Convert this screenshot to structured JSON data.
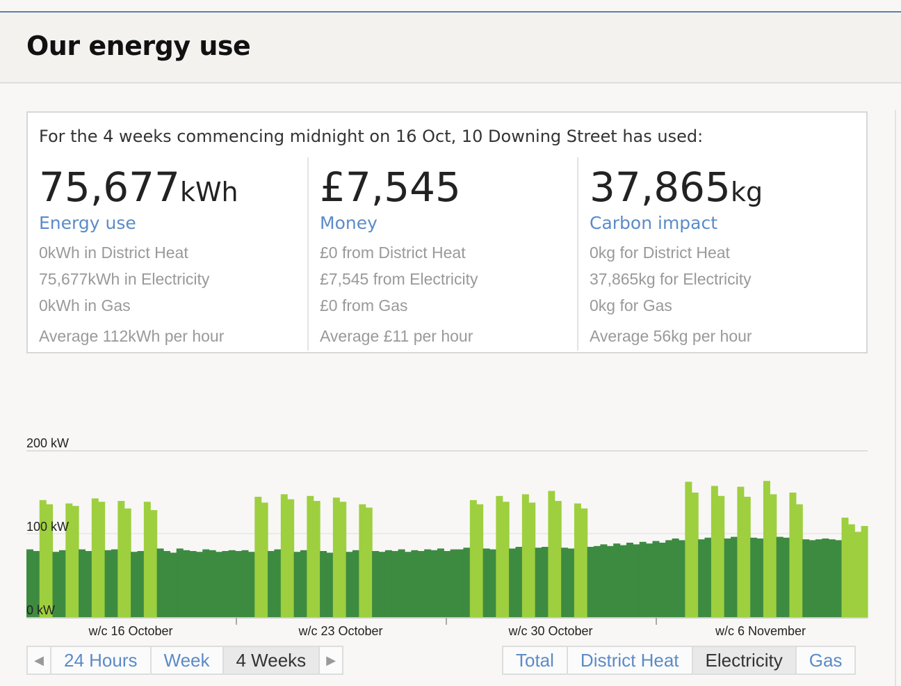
{
  "page": {
    "title": "Our energy use"
  },
  "summary": {
    "intro": "For the 4 weeks commencing midnight on 16 Oct, 10 Downing Street has used:",
    "energy": {
      "value": "75,677",
      "unit": "kWh",
      "label": "Energy use",
      "lines": [
        "0kWh in District Heat",
        "75,677kWh in Electricity",
        "0kWh in Gas",
        "Average 112kWh per hour"
      ]
    },
    "money": {
      "value": "£7,545",
      "unit": "",
      "label": "Money",
      "lines": [
        "£0 from District Heat",
        "£7,545 from Electricity",
        "£0 from Gas",
        "Average £11 per hour"
      ]
    },
    "carbon": {
      "value": "37,865",
      "unit": "kg",
      "label": "Carbon impact",
      "lines": [
        "0kg for District Heat",
        "37,865kg for Electricity",
        "0kg for Gas",
        "Average 56kg per hour"
      ]
    }
  },
  "chart_data": {
    "type": "area",
    "y_ticks": [
      "200 kW",
      "100 kW",
      "0 kW"
    ],
    "ylim": [
      0,
      200
    ],
    "x_labels": [
      "w/c 16 October",
      "w/c 23 October",
      "w/c 30 October",
      "w/c 6 November"
    ],
    "colors": {
      "night": "#3d8b40",
      "day": "#9ecf3f",
      "grid": "#dddddd"
    },
    "series": [
      {
        "values": [
          82,
          80,
          141,
          136,
          79,
          81,
          137,
          134,
          82,
          80,
          143,
          139,
          81,
          82,
          140,
          131,
          79,
          80,
          139,
          129,
          83,
          80,
          78,
          83,
          81,
          80,
          79,
          82,
          81,
          79,
          80,
          81,
          80,
          81,
          79,
          145,
          138,
          80,
          82,
          148,
          142,
          79,
          81,
          146,
          140,
          80,
          78,
          144,
          139,
          79,
          81,
          136,
          132,
          80,
          79,
          81,
          80,
          82,
          79,
          81,
          80,
          82,
          81,
          83,
          80,
          82,
          82,
          84,
          141,
          136,
          83,
          82,
          146,
          139,
          83,
          85,
          148,
          138,
          84,
          85,
          152,
          140,
          84,
          83,
          137,
          131,
          85,
          86,
          88,
          86,
          89,
          87,
          90,
          88,
          91,
          89,
          92,
          90,
          93,
          95,
          93,
          163,
          150,
          94,
          96,
          158,
          146,
          95,
          97,
          157,
          145,
          96,
          95,
          164,
          148,
          97,
          96,
          150,
          136,
          94,
          93,
          94,
          95,
          94,
          93,
          120,
          112,
          103,
          110
        ]
      }
    ]
  },
  "controls": {
    "range": {
      "prev": "◀",
      "items": [
        "24 Hours",
        "Week",
        "4 Weeks"
      ],
      "next": "▶",
      "active": "4 Weeks"
    },
    "fuel": {
      "items": [
        "Total",
        "District Heat",
        "Electricity",
        "Gas"
      ],
      "active": "Electricity"
    }
  }
}
